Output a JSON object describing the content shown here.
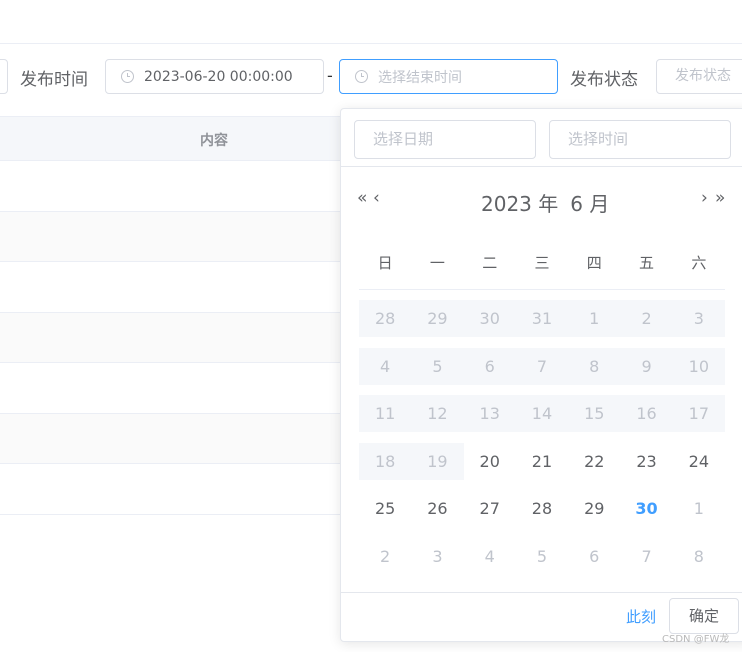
{
  "filters": {
    "publish_time_label": "发布时间",
    "start_date_value": "2023-06-20 00:00:00",
    "separator": "-",
    "end_date_placeholder": "选择结束时间",
    "publish_status_label": "发布状态",
    "publish_status_placeholder": "发布状态"
  },
  "table": {
    "content_header": "内容",
    "row_count": 7
  },
  "picker": {
    "date_placeholder": "选择日期",
    "time_placeholder": "选择时间",
    "nav": {
      "prev_year": "«",
      "prev_month": "‹",
      "next_month": "›",
      "next_year": "»"
    },
    "year_label": "2023 年",
    "month_label": "6 月",
    "weekdays": [
      "日",
      "一",
      "二",
      "三",
      "四",
      "五",
      "六"
    ],
    "weeks": [
      [
        "28",
        "29",
        "30",
        "31",
        "1",
        "2",
        "3"
      ],
      [
        "4",
        "5",
        "6",
        "7",
        "8",
        "9",
        "10"
      ],
      [
        "11",
        "12",
        "13",
        "14",
        "15",
        "16",
        "17"
      ],
      [
        "18",
        "19",
        "20",
        "21",
        "22",
        "23",
        "24"
      ],
      [
        "25",
        "26",
        "27",
        "28",
        "29",
        "30",
        "1"
      ],
      [
        "2",
        "3",
        "4",
        "5",
        "6",
        "7",
        "8"
      ]
    ],
    "now_label": "此刻",
    "confirm_label": "确定"
  },
  "colors": {
    "accent": "#409eff",
    "disabled_bg": "#f5f7fa",
    "muted": "#c0c4cc"
  },
  "watermark": "CSDN @FW龙"
}
